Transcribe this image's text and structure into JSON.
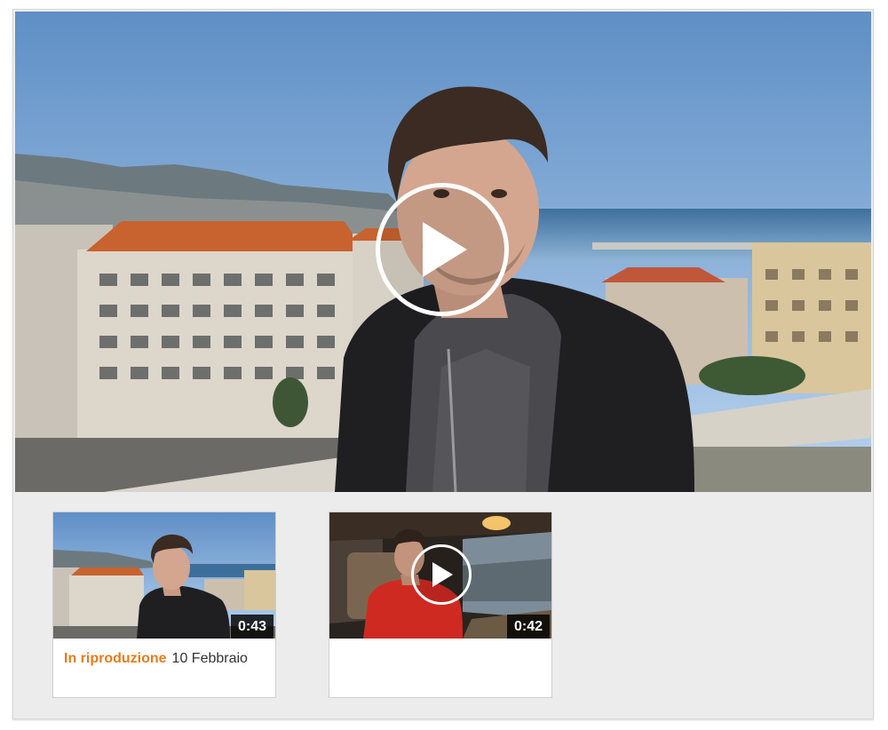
{
  "player": {
    "play_icon": "play-icon"
  },
  "playlist": {
    "items": [
      {
        "duration": "0:43",
        "status": "In riproduzione",
        "title": "10 Febbraio",
        "state": "playing"
      },
      {
        "duration": "0:42",
        "status": "",
        "title": "",
        "state": "queued",
        "play_icon": "play-icon"
      }
    ]
  },
  "colors": {
    "accent": "#e37d1c",
    "strip_bg": "#ececec",
    "duration_bg": "#000000"
  }
}
